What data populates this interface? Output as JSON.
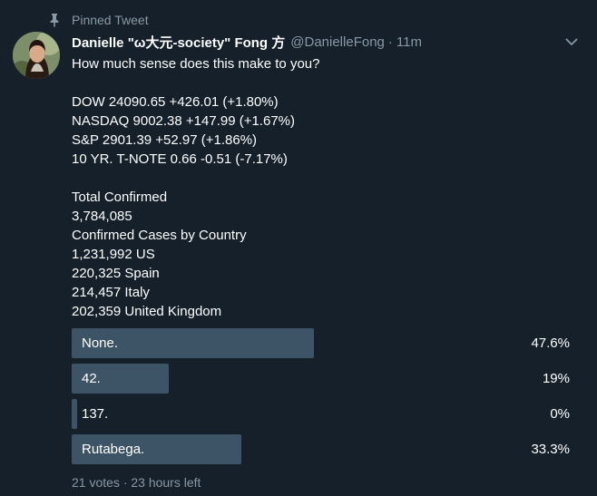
{
  "pinned_label": "Pinned Tweet",
  "author": {
    "display_name": "Danielle \"ω大元-society\" Fong 方",
    "handle": "@DanielleFong",
    "separator": "·",
    "time": "11m"
  },
  "tweet_lines": [
    "How much sense does this make to you?",
    "",
    "DOW 24090.65 +426.01 (+1.80%)",
    "NASDAQ 9002.38 +147.99 (+1.67%)",
    "S&P 2901.39 +52.97 (+1.86%)",
    "10 YR. T-NOTE 0.66 -0.51 (-7.17%)",
    "",
    "Total Confirmed",
    "3,784,085",
    "Confirmed Cases by Country",
    "1,231,992 US",
    "220,325 Spain",
    "214,457 Italy",
    "202,359 United Kingdom"
  ],
  "poll": {
    "options": [
      {
        "label": "None.",
        "percent_text": "47.6%",
        "fraction": 0.476
      },
      {
        "label": "42.",
        "percent_text": "19%",
        "fraction": 0.19
      },
      {
        "label": "137.",
        "percent_text": "0%",
        "fraction": 0.0
      },
      {
        "label": "Rutabega.",
        "percent_text": "33.3%",
        "fraction": 0.333
      }
    ],
    "footer": "21 votes · 23 hours left"
  },
  "icons": {
    "pin": "pin-icon",
    "caret": "chevron-down-icon",
    "avatar": "avatar"
  },
  "colors": {
    "background": "#15202b",
    "muted_text": "#8899a6",
    "poll_bar": "#3d5466"
  }
}
